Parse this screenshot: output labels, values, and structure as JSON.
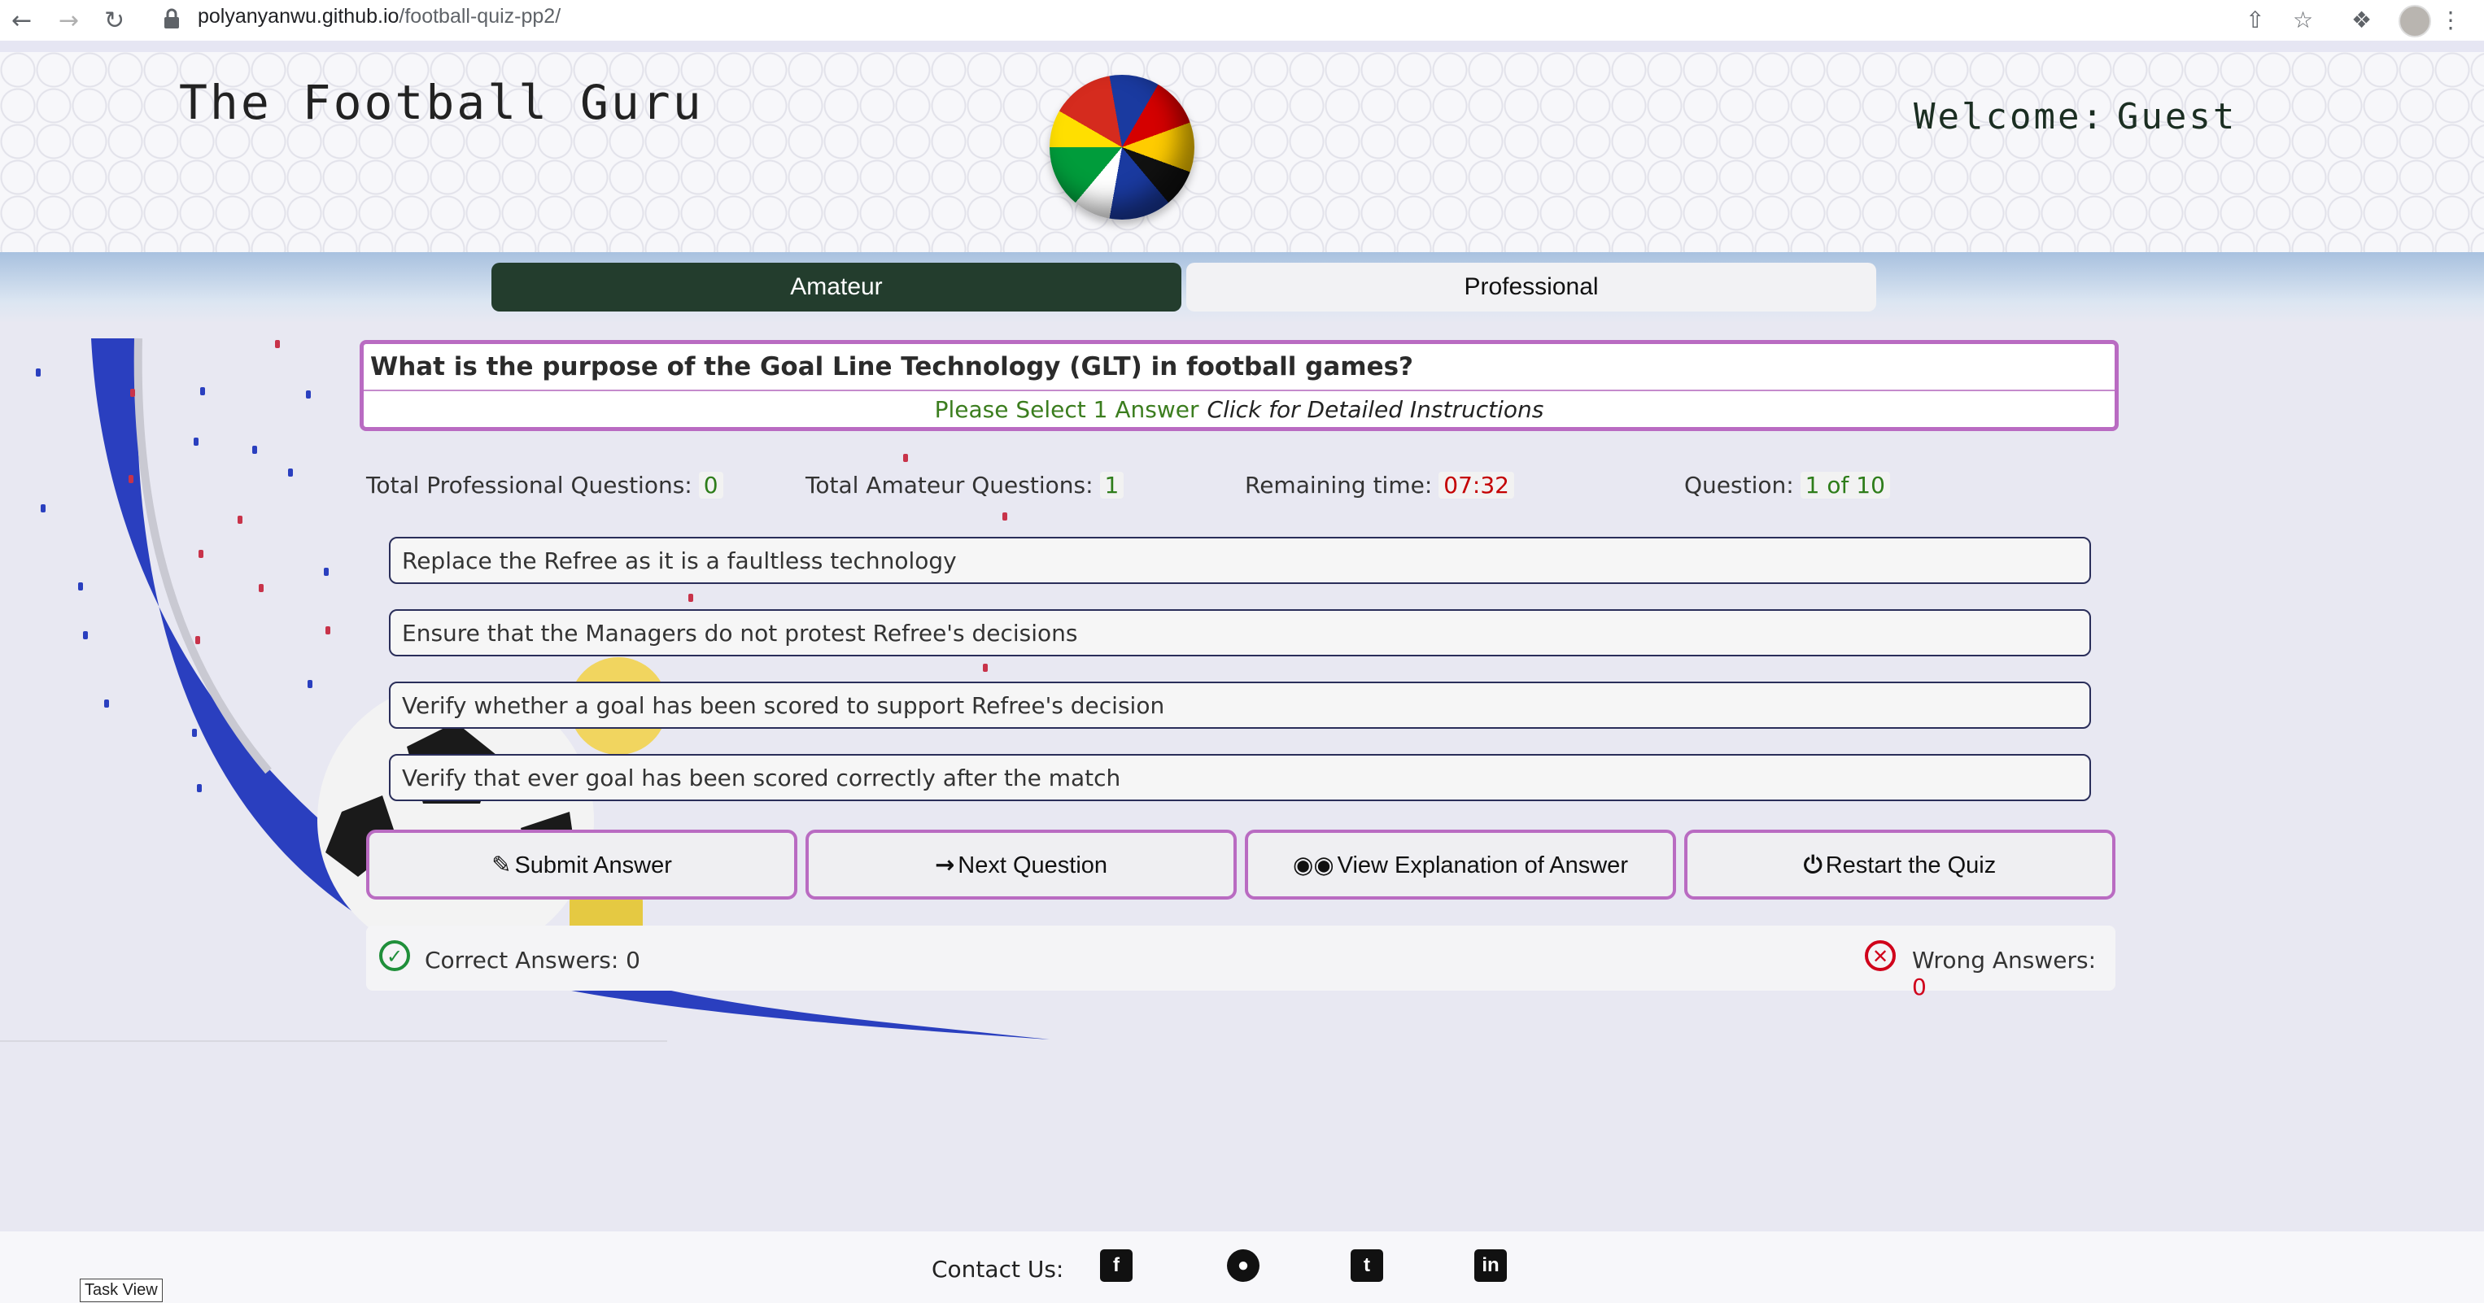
{
  "browser": {
    "url_domain": "polyanyanwu.github.io",
    "url_path": "/football-quiz-pp2/"
  },
  "header": {
    "site_title": "The Football Guru",
    "welcome_label": "Welcome:",
    "username": "Guest"
  },
  "tabs": {
    "amateur": "Amateur",
    "professional": "Professional"
  },
  "quiz": {
    "question": "What is the purpose of the Goal Line Technology (GLT) in football games?",
    "instruction_select": "Please Select 1 Answer",
    "instruction_detail": "Click for Detailed Instructions",
    "stats": {
      "professional_label": "Total Professional Questions:",
      "professional_count": "0",
      "amateur_label": "Total Amateur Questions:",
      "amateur_count": "1",
      "time_label": "Remaining time:",
      "time_value": "07:32",
      "question_label": "Question:",
      "question_value": "1 of 10"
    },
    "answers": [
      "Replace the Refree as it is a faultless technology",
      "Ensure that the Managers do not protest Refree's decisions",
      "Verify whether a goal has been scored to support Refree's decision",
      "Verify that ever goal has been scored correctly after the match"
    ],
    "buttons": {
      "submit": "Submit Answer",
      "next": "Next Question",
      "explanation": "View Explanation of Answer",
      "restart": "Restart the Quiz"
    },
    "score": {
      "correct_label": "Correct Answers:",
      "correct_value": "0",
      "wrong_label": "Wrong Answers:",
      "wrong_value": "0"
    }
  },
  "footer": {
    "contact_label": "Contact Us:",
    "social": [
      "facebook",
      "github",
      "twitter",
      "linkedin"
    ]
  },
  "taskbar": {
    "task_view": "Task View"
  },
  "colors": {
    "accent_purple": "#b96bc2",
    "active_tab": "#233d2d",
    "correct_green": "#1f8f3a",
    "wrong_red": "#d0021b"
  }
}
